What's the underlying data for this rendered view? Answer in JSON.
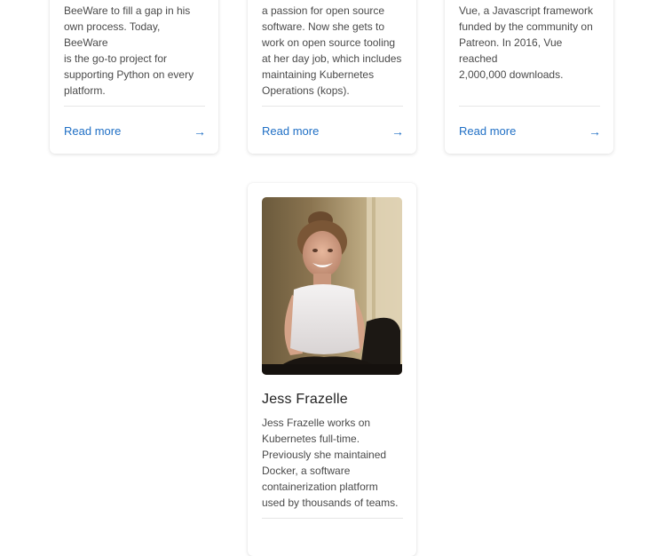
{
  "cards": [
    {
      "description": "BeeWare to fill a gap in his\nown process. Today, BeeWare\nis the go-to project for\nsupporting Python on every\nplatform.",
      "read_more": "Read more",
      "arrow": "→"
    },
    {
      "description": "a passion for open source\nsoftware. Now she gets to\nwork on open source tooling\nat her day job, which includes\nmaintaining Kubernetes\nOperations (kops).",
      "read_more": "Read more",
      "arrow": "→"
    },
    {
      "description": "Vue, a Javascript framework\nfunded by the community on\nPatreon. In 2016, Vue reached\n2,000,000 downloads.",
      "read_more": "Read more",
      "arrow": "→"
    }
  ],
  "featured": {
    "name": "Jess Frazelle",
    "description": "Jess Frazelle works on\nKubernetes full-time.\nPreviously she maintained\nDocker, a software\ncontainerization platform\nused by thousands of teams."
  },
  "colors": {
    "link": "#1f6fc5",
    "divider": "#e6e6e6"
  }
}
